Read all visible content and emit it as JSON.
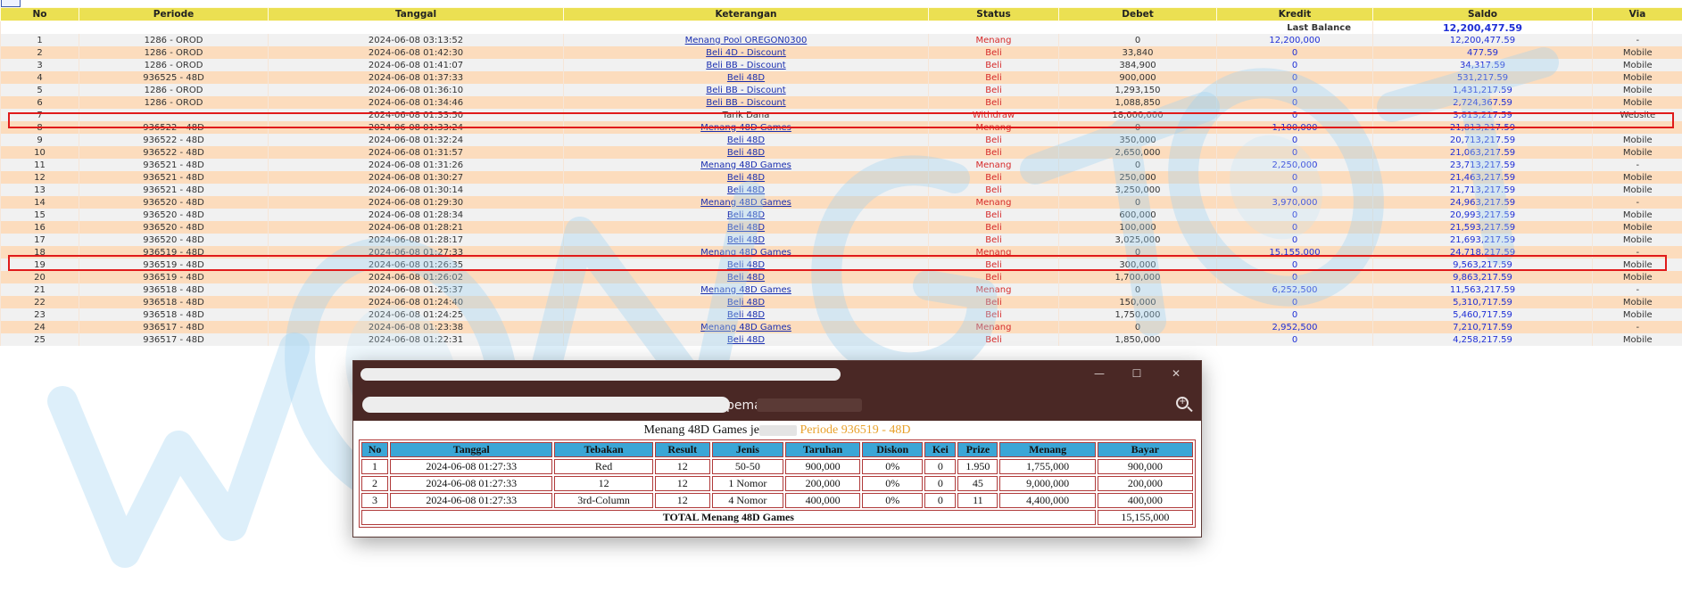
{
  "columns": [
    "No",
    "Periode",
    "Tanggal",
    "Keterangan",
    "Status",
    "Debet",
    "Kredit",
    "Saldo",
    "Via"
  ],
  "last_balance": {
    "label": "Last Balance",
    "saldo": "12,200,477.59"
  },
  "rows": [
    {
      "no": "1",
      "periode": "1286 - OROD",
      "tanggal": "2024-06-08 03:13:52",
      "ket": "Menang Pool OREGON0300",
      "status": "Menang",
      "debet": "0",
      "kredit": "12,200,000",
      "saldo": "12,200,477.59",
      "via": "-"
    },
    {
      "no": "2",
      "periode": "1286 - OROD",
      "tanggal": "2024-06-08 01:42:30",
      "ket": "Beli 4D - Discount",
      "status": "Beli",
      "debet": "33,840",
      "kredit": "0",
      "saldo": "477.59",
      "via": "Mobile"
    },
    {
      "no": "3",
      "periode": "1286 - OROD",
      "tanggal": "2024-06-08 01:41:07",
      "ket": "Beli BB - Discount",
      "status": "Beli",
      "debet": "384,900",
      "kredit": "0",
      "saldo": "34,317.59",
      "via": "Mobile"
    },
    {
      "no": "4",
      "periode": "936525 - 48D",
      "tanggal": "2024-06-08 01:37:33",
      "ket": "Beli 48D",
      "status": "Beli",
      "debet": "900,000",
      "kredit": "0",
      "saldo": "531,217.59",
      "via": "Mobile"
    },
    {
      "no": "5",
      "periode": "1286 - OROD",
      "tanggal": "2024-06-08 01:36:10",
      "ket": "Beli BB - Discount",
      "status": "Beli",
      "debet": "1,293,150",
      "kredit": "0",
      "saldo": "1,431,217.59",
      "via": "Mobile"
    },
    {
      "no": "6",
      "periode": "1286 - OROD",
      "tanggal": "2024-06-08 01:34:46",
      "ket": "Beli BB - Discount",
      "status": "Beli",
      "debet": "1,088,850",
      "kredit": "0",
      "saldo": "2,724,367.59",
      "via": "Mobile"
    },
    {
      "no": "7",
      "periode": "",
      "tanggal": "2024-06-08 01:33:50",
      "ket": "Tarik Dana",
      "status": "Withdraw",
      "debet": "18,000,000",
      "kredit": "0",
      "saldo": "3,813,217.59",
      "via": "Website"
    },
    {
      "no": "8",
      "periode": "936522 - 48D",
      "tanggal": "2024-06-08 01:33:24",
      "ket": "Menang 48D Games",
      "status": "Menang",
      "debet": "0",
      "kredit": "1,100,000",
      "saldo": "21,813,217.59",
      "via": "-"
    },
    {
      "no": "9",
      "periode": "936522 - 48D",
      "tanggal": "2024-06-08 01:32:24",
      "ket": "Beli 48D",
      "status": "Beli",
      "debet": "350,000",
      "kredit": "0",
      "saldo": "20,713,217.59",
      "via": "Mobile"
    },
    {
      "no": "10",
      "periode": "936522 - 48D",
      "tanggal": "2024-06-08 01:31:57",
      "ket": "Beli 48D",
      "status": "Beli",
      "debet": "2,650,000",
      "kredit": "0",
      "saldo": "21,063,217.59",
      "via": "Mobile"
    },
    {
      "no": "11",
      "periode": "936521 - 48D",
      "tanggal": "2024-06-08 01:31:26",
      "ket": "Menang 48D Games",
      "status": "Menang",
      "debet": "0",
      "kredit": "2,250,000",
      "saldo": "23,713,217.59",
      "via": "-"
    },
    {
      "no": "12",
      "periode": "936521 - 48D",
      "tanggal": "2024-06-08 01:30:27",
      "ket": "Beli 48D",
      "status": "Beli",
      "debet": "250,000",
      "kredit": "0",
      "saldo": "21,463,217.59",
      "via": "Mobile"
    },
    {
      "no": "13",
      "periode": "936521 - 48D",
      "tanggal": "2024-06-08 01:30:14",
      "ket": "Beli 48D",
      "status": "Beli",
      "debet": "3,250,000",
      "kredit": "0",
      "saldo": "21,713,217.59",
      "via": "Mobile"
    },
    {
      "no": "14",
      "periode": "936520 - 48D",
      "tanggal": "2024-06-08 01:29:30",
      "ket": "Menang 48D Games",
      "status": "Menang",
      "debet": "0",
      "kredit": "3,970,000",
      "saldo": "24,963,217.59",
      "via": "-"
    },
    {
      "no": "15",
      "periode": "936520 - 48D",
      "tanggal": "2024-06-08 01:28:34",
      "ket": "Beli 48D",
      "status": "Beli",
      "debet": "600,000",
      "kredit": "0",
      "saldo": "20,993,217.59",
      "via": "Mobile"
    },
    {
      "no": "16",
      "periode": "936520 - 48D",
      "tanggal": "2024-06-08 01:28:21",
      "ket": "Beli 48D",
      "status": "Beli",
      "debet": "100,000",
      "kredit": "0",
      "saldo": "21,593,217.59",
      "via": "Mobile"
    },
    {
      "no": "17",
      "periode": "936520 - 48D",
      "tanggal": "2024-06-08 01:28:17",
      "ket": "Beli 48D",
      "status": "Beli",
      "debet": "3,025,000",
      "kredit": "0",
      "saldo": "21,693,217.59",
      "via": "Mobile"
    },
    {
      "no": "18",
      "periode": "936519 - 48D",
      "tanggal": "2024-06-08 01:27:33",
      "ket": "Menang 48D Games",
      "status": "Menang",
      "debet": "0",
      "kredit": "15,155,000",
      "saldo": "24,718,217.59",
      "via": "-"
    },
    {
      "no": "19",
      "periode": "936519 - 48D",
      "tanggal": "2024-06-08 01:26:35",
      "ket": "Beli 48D",
      "status": "Beli",
      "debet": "300,000",
      "kredit": "0",
      "saldo": "9,563,217.59",
      "via": "Mobile"
    },
    {
      "no": "20",
      "periode": "936519 - 48D",
      "tanggal": "2024-06-08 01:26:02",
      "ket": "Beli 48D",
      "status": "Beli",
      "debet": "1,700,000",
      "kredit": "0",
      "saldo": "9,863,217.59",
      "via": "Mobile"
    },
    {
      "no": "21",
      "periode": "936518 - 48D",
      "tanggal": "2024-06-08 01:25:37",
      "ket": "Menang 48D Games",
      "status": "Menang",
      "debet": "0",
      "kredit": "6,252,500",
      "saldo": "11,563,217.59",
      "via": "-"
    },
    {
      "no": "22",
      "periode": "936518 - 48D",
      "tanggal": "2024-06-08 01:24:40",
      "ket": "Beli 48D",
      "status": "Beli",
      "debet": "150,000",
      "kredit": "0",
      "saldo": "5,310,717.59",
      "via": "Mobile"
    },
    {
      "no": "23",
      "periode": "936518 - 48D",
      "tanggal": "2024-06-08 01:24:25",
      "ket": "Beli 48D",
      "status": "Beli",
      "debet": "1,750,000",
      "kredit": "0",
      "saldo": "5,460,717.59",
      "via": "Mobile"
    },
    {
      "no": "24",
      "periode": "936517 - 48D",
      "tanggal": "2024-06-08 01:23:38",
      "ket": "Menang 48D Games",
      "status": "Menang",
      "debet": "0",
      "kredit": "2,952,500",
      "saldo": "7,210,717.59",
      "via": "-"
    },
    {
      "no": "25",
      "periode": "936517 - 48D",
      "tanggal": "2024-06-08 01:22:31",
      "ket": "Beli 48D",
      "status": "Beli",
      "debet": "1,850,000",
      "kredit": "0",
      "saldo": "4,258,217.59",
      "via": "Mobile"
    }
  ],
  "highlighted_rows": [
    "7",
    "18"
  ],
  "popup": {
    "window_buttons": {
      "minimize": "—",
      "maximize": "☐",
      "close": "✕"
    },
    "url_suffix": "pemain=je",
    "heading_prefix": "Menang 48D Games je",
    "heading_periode": "Periode 936519 - 48D",
    "columns": [
      "No",
      "Tanggal",
      "Tebakan",
      "Result",
      "Jenis",
      "Taruhan",
      "Diskon",
      "Kei",
      "Prize",
      "Menang",
      "Bayar"
    ],
    "rows": [
      [
        "1",
        "2024-06-08 01:27:33",
        "Red",
        "12",
        "50-50",
        "900,000",
        "0%",
        "0",
        "1.950",
        "1,755,000",
        "900,000"
      ],
      [
        "2",
        "2024-06-08 01:27:33",
        "12",
        "12",
        "1 Nomor",
        "200,000",
        "0%",
        "0",
        "45",
        "9,000,000",
        "200,000"
      ],
      [
        "3",
        "2024-06-08 01:27:33",
        "3rd-Column",
        "12",
        "4 Nomor",
        "400,000",
        "0%",
        "0",
        "11",
        "4,400,000",
        "400,000"
      ]
    ],
    "total_label": "TOTAL  Menang 48D Games",
    "total_value": "15,155,000"
  },
  "colors": {
    "header": "#ebe052",
    "row_odd": "#f1f1f1",
    "row_even": "#fcdcbd",
    "status_red": "#d62b2b",
    "link": "#1a2fb0",
    "highlight": "#e01b1b",
    "popup_bar": "#4a2825",
    "popup_th": "#3ba6d6"
  },
  "icons": {
    "zoom": "magnifier-plus-icon",
    "window": "window-icon"
  }
}
